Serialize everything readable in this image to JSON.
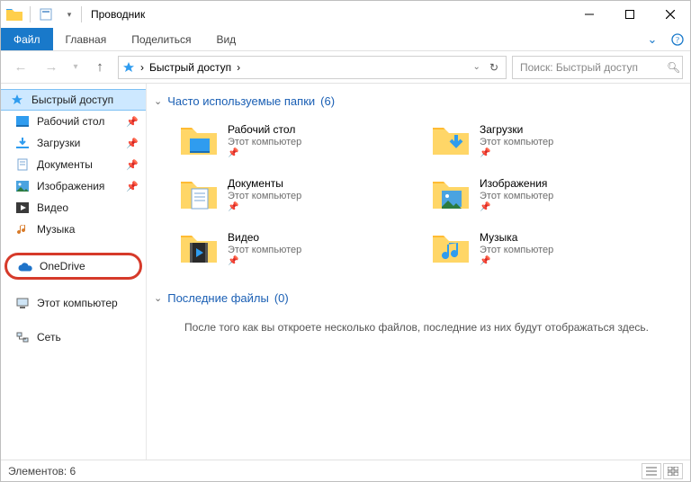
{
  "title": "Проводник",
  "ribbon": {
    "file": "Файл",
    "home": "Главная",
    "share": "Поделиться",
    "view": "Вид"
  },
  "breadcrumb": {
    "root": "Быстрый доступ"
  },
  "search": {
    "placeholder": "Поиск: Быстрый доступ"
  },
  "sidebar": {
    "quick_access": "Быстрый доступ",
    "items": [
      {
        "label": "Рабочий стол",
        "pinned": true
      },
      {
        "label": "Загрузки",
        "pinned": true
      },
      {
        "label": "Документы",
        "pinned": true
      },
      {
        "label": "Изображения",
        "pinned": true
      },
      {
        "label": "Видео",
        "pinned": false
      },
      {
        "label": "Музыка",
        "pinned": false
      }
    ],
    "onedrive": "OneDrive",
    "this_pc": "Этот компьютер",
    "network": "Сеть"
  },
  "sections": {
    "frequent": {
      "title": "Часто используемые папки",
      "count": "(6)"
    },
    "recent": {
      "title": "Последние файлы",
      "count": "(0)"
    }
  },
  "folders": [
    {
      "name": "Рабочий стол",
      "sub": "Этот компьютер"
    },
    {
      "name": "Загрузки",
      "sub": "Этот компьютер"
    },
    {
      "name": "Документы",
      "sub": "Этот компьютер"
    },
    {
      "name": "Изображения",
      "sub": "Этот компьютер"
    },
    {
      "name": "Видео",
      "sub": "Этот компьютер"
    },
    {
      "name": "Музыка",
      "sub": "Этот компьютер"
    }
  ],
  "empty_recent": "После того как вы откроете несколько файлов, последние из них будут отображаться здесь.",
  "status": {
    "elements_label": "Элементов:",
    "count": "6"
  }
}
